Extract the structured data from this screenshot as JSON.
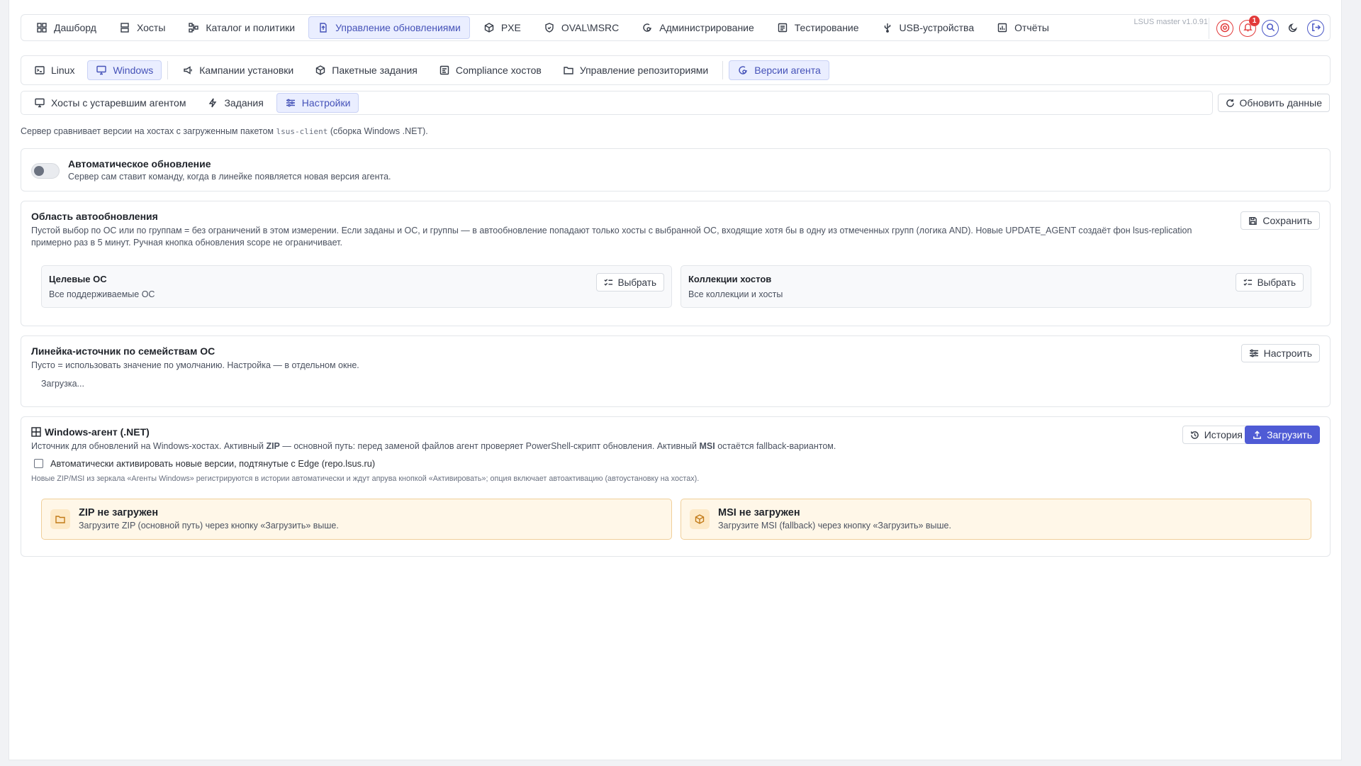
{
  "app": {
    "version": "LSUS master v1.0.91",
    "notifications_count": "1"
  },
  "topnav": {
    "items": [
      {
        "label": "Дашборд",
        "icon": "dashboard-icon"
      },
      {
        "label": "Хосты",
        "icon": "hosts-icon"
      },
      {
        "label": "Каталог и политики",
        "icon": "catalog-icon"
      },
      {
        "label": "Управление обновлениями",
        "icon": "updates-icon",
        "active": true
      },
      {
        "label": "PXE",
        "icon": "cube-icon"
      },
      {
        "label": "OVAL\\MSRC",
        "icon": "shield-icon"
      },
      {
        "label": "Администрирование",
        "icon": "admin-icon"
      },
      {
        "label": "Тестирование",
        "icon": "testing-icon"
      },
      {
        "label": "USB-устройства",
        "icon": "usb-icon"
      },
      {
        "label": "Отчёты",
        "icon": "reports-icon"
      }
    ]
  },
  "subnav": {
    "os_linux": "Linux",
    "os_windows": "Windows",
    "items": [
      {
        "label": "Кампании установки",
        "icon": "megaphone-icon"
      },
      {
        "label": "Пакетные задания",
        "icon": "package-icon"
      },
      {
        "label": "Compliance хостов",
        "icon": "compliance-icon"
      },
      {
        "label": "Управление репозиториями",
        "icon": "folder-icon"
      }
    ],
    "agent_versions": "Версии агента"
  },
  "tabs": {
    "outdated": "Хосты с устаревшим агентом",
    "jobs": "Задания",
    "settings": "Настройки",
    "refresh": "Обновить данные"
  },
  "desc": {
    "before": "Сервер сравнивает версии на хостах с загруженным пакетом ",
    "package": "lsus-client",
    "after": " (сборка Windows .NET)."
  },
  "auto_update": {
    "title": "Автоматическое обновление",
    "subtitle": "Сервер сам ставит команду, когда в линейке появляется новая версия агента.",
    "enabled": false
  },
  "scope": {
    "title": "Область автообновления",
    "description": "Пустой выбор по ОС или по группам = без ограничений в этом измерении. Если заданы и ОС, и группы — в автообновление попадают только хосты с выбранной ОС, входящие хотя бы в одну из отмеченных групп (логика AND). Новые UPDATE_AGENT создаёт фон lsus-replication примерно раз в 5 минут. Ручная кнопка обновления scope не ограничивает.",
    "save": "Сохранить",
    "os_title": "Целевые ОС",
    "os_value": "Все поддерживаемые ОС",
    "coll_title": "Коллекции хостов",
    "coll_value": "Все коллекции и хосты",
    "select": "Выбрать"
  },
  "lineage": {
    "title": "Линейка-источник по семействам ОС",
    "subtitle": "Пусто = использовать значение по умолчанию. Настройка — в отдельном окне.",
    "configure": "Настроить",
    "loading": "Загрузка..."
  },
  "windows_agent": {
    "title": "Windows-агент (.NET)",
    "desc_1": "Источник для обновлений на Windows-хостах. Активный ",
    "zip": "ZIP",
    "desc_2": " — основной путь: перед заменой файлов агент проверяет PowerShell-скрипт обновления. Активный ",
    "msi": "MSI",
    "desc_3": " остаётся fallback-вариантом.",
    "history": "История",
    "upload": "Загрузить",
    "auto_activate": "Автоматически активировать новые версии, подтянутые с Edge (repo.lsus.ru)",
    "auto_activate_hint": "Новые ZIP/MSI из зеркала «Агенты Windows» регистрируются в истории автоматически и ждут апрува кнопкой «Активировать»; опция включает автоактивацию (автоустановку на хостах).",
    "zip_title": "ZIP не загружен",
    "zip_sub": "Загрузите ZIP (основной путь) через кнопку «Загрузить» выше.",
    "msi_title": "MSI не загружен",
    "msi_sub": "Загрузите MSI (fallback) через кнопку «Загрузить» выше."
  },
  "colors": {
    "accent": "#4f5bd5",
    "active_bg": "#eaeeff",
    "warning_bg": "#fff7e8",
    "danger": "#e23a3a"
  }
}
